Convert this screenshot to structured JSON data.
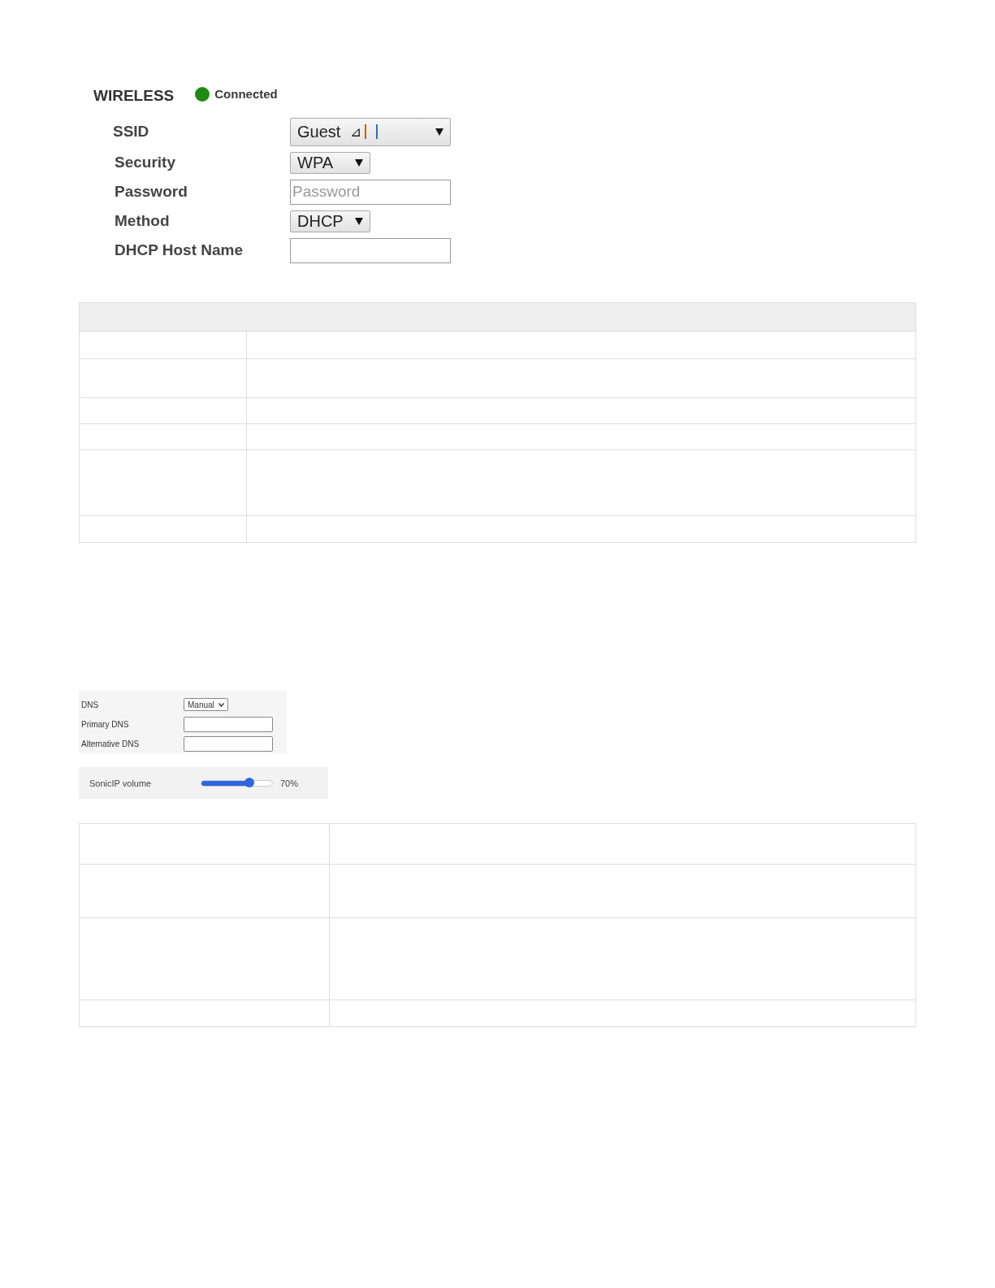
{
  "wireless": {
    "title": "WIRELESS",
    "status": {
      "label": "Connected",
      "color": "#1e8a12"
    },
    "fields": [
      {
        "label": "SSID",
        "kind": "select",
        "value": "Guest",
        "signal": "⊿",
        "wide": true
      },
      {
        "label": "Security",
        "kind": "select",
        "value": "WPA"
      },
      {
        "label": "Password",
        "kind": "input",
        "placeholder": "Password"
      },
      {
        "label": "Method",
        "kind": "select",
        "value": "DHCP"
      },
      {
        "label": "DHCP Host Name",
        "kind": "input"
      }
    ]
  },
  "dns": {
    "fields": [
      {
        "label": "DNS",
        "kind": "select",
        "value": "Manual"
      },
      {
        "label": "Primary DNS",
        "kind": "input"
      },
      {
        "label": "Alternative DNS",
        "kind": "input"
      }
    ]
  },
  "volume": {
    "label": "SonicIP volume",
    "level": 0.68,
    "reading": "70%"
  }
}
